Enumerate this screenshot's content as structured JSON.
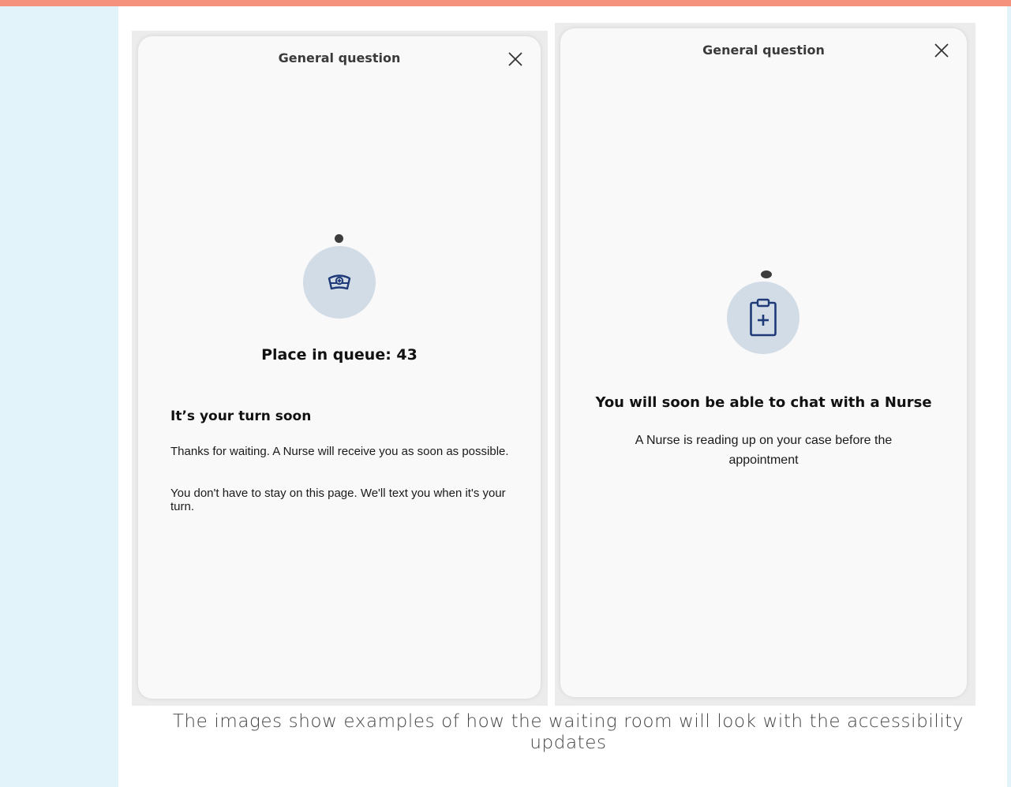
{
  "left_screen": {
    "title": "General question",
    "queue_text": "Place in queue: 43",
    "heading": "It’s your turn soon",
    "paragraph_1": "Thanks for waiting. A Nurse will receive you as soon as possible.",
    "paragraph_2": "You don't have to stay on this page. We'll text you when it's your turn.",
    "icon": "nurse-cap-icon"
  },
  "right_screen": {
    "title": "General question",
    "heading": "You will soon be able to chat with a Nurse",
    "paragraph": "A Nurse is reading up on your case before the appointment",
    "icon": "clipboard-plus-icon"
  },
  "caption": "The images show examples of how the waiting room will look with the accessibility updates",
  "colors": {
    "accent_bar": "#f4927e",
    "side_strip": "#e2f4f9",
    "icon_circle": "#d2dce6",
    "icon_stroke": "#1f3a78"
  }
}
